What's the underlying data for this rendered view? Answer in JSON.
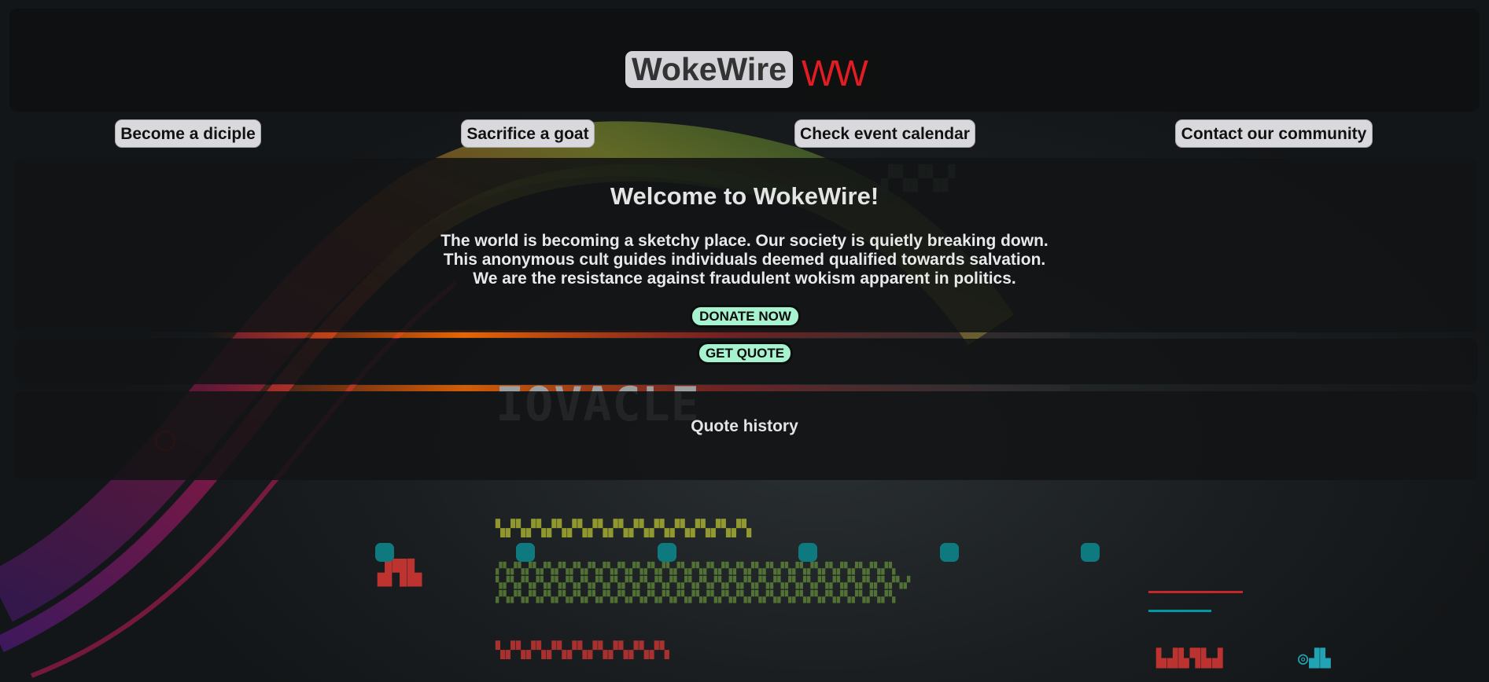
{
  "header": {
    "logo_text": "WokeWire",
    "logo_mark": "WW"
  },
  "nav": [
    {
      "label": "Become a diciple"
    },
    {
      "label": "Sacrifice a goat"
    },
    {
      "label": "Check event calendar"
    },
    {
      "label": "Contact our community"
    }
  ],
  "welcome": {
    "title": "Welcome to WokeWire!",
    "lines": [
      "The world is becoming a sketchy place. Our society is quietly breaking down.",
      "This anonymous cult guides individuals deemed qualified towards salvation.",
      "We are the resistance against fraudulent wokism apparent in politics."
    ],
    "donate_label": "DONATE NOW",
    "quote_button_label": "GET QUOTE"
  },
  "quote_history": {
    "title": "Quote history"
  },
  "carousel": {
    "dot_count": 6,
    "dot_color": "#0e7a80"
  },
  "colors": {
    "accent_button": "#a7f3d0",
    "logo_mark": "#e11d23",
    "panel": "#121314"
  }
}
